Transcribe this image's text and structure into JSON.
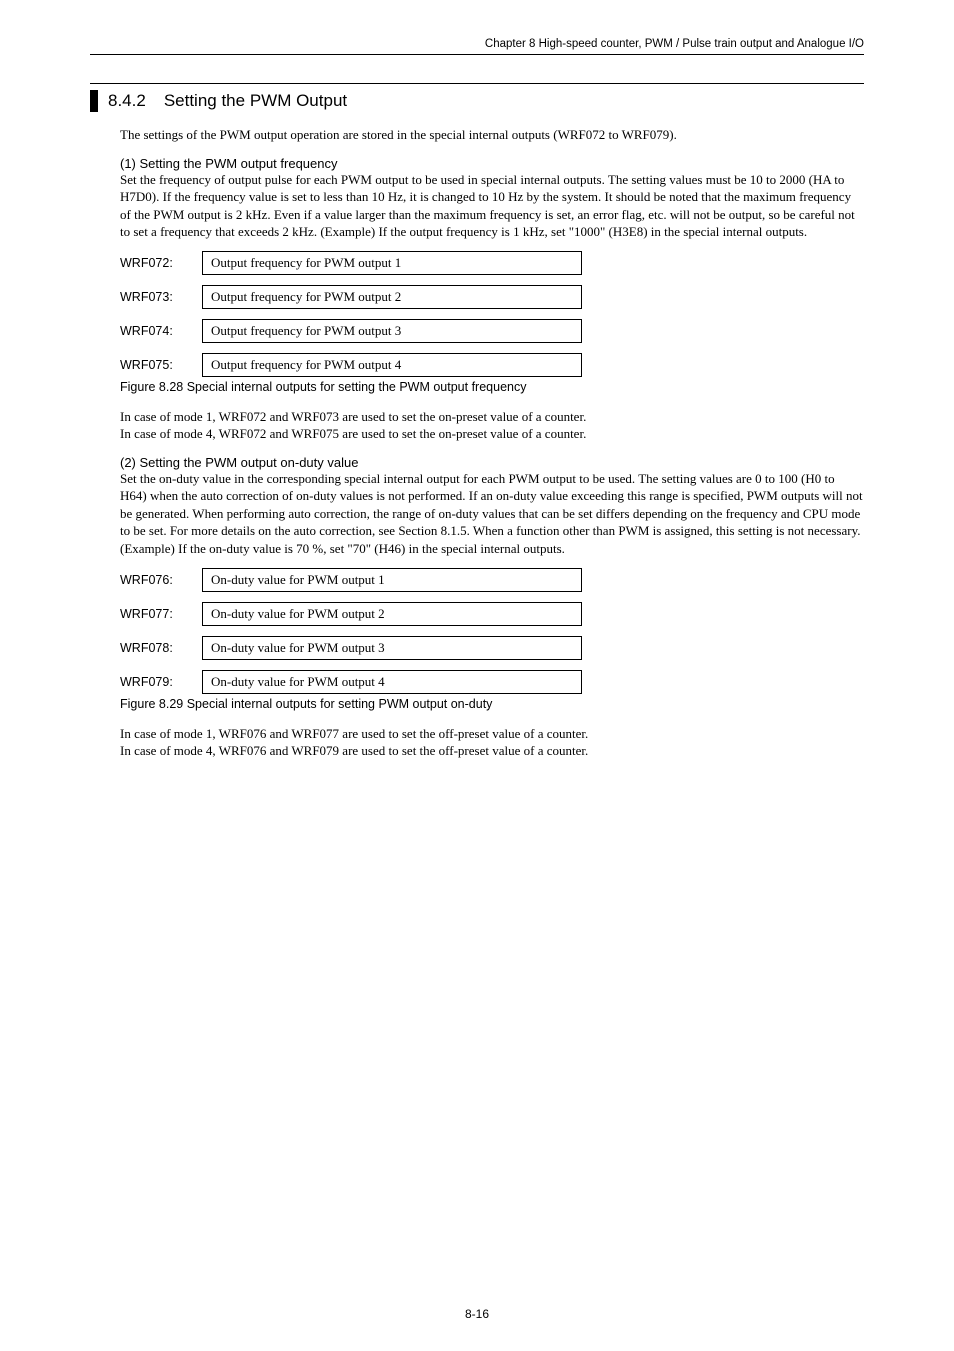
{
  "header": "Chapter 8  High-speed counter, PWM / Pulse train output and Analogue I/O",
  "section": {
    "number": "8.4.2",
    "title": "Setting the PWM Output"
  },
  "intro": "The settings of the PWM output operation are stored in the special internal outputs (WRF072 to WRF079).",
  "part1": {
    "heading": "(1)   Setting the PWM output frequency",
    "body": "Set the frequency of output pulse for each PWM output to be used in special internal outputs.  The setting values must be 10 to 2000 (HA to H7D0). If the frequency value is set to less than 10 Hz, it is changed to 10 Hz by the system. It should be noted that the maximum frequency of the PWM output is 2 kHz. Even if a value larger than the maximum frequency is set, an error flag, etc. will not be output, so be careful not to set a frequency that exceeds 2 kHz. (Example) If the output frequency is 1 kHz, set \"1000\" (H3E8) in the special internal outputs.",
    "regs": [
      {
        "label": "WRF072:",
        "desc": "Output frequency for PWM output 1"
      },
      {
        "label": "WRF073:",
        "desc": "Output frequency for PWM output 2"
      },
      {
        "label": "WRF074:",
        "desc": "Output frequency for PWM output 3"
      },
      {
        "label": "WRF075:",
        "desc": "Output frequency for PWM output 4"
      }
    ],
    "caption": "Figure 8.28 Special internal outputs for setting the PWM output frequency",
    "note1": "In case of mode 1, WRF072 and WRF073 are used to set the on-preset value of a counter.",
    "note2": "In case of mode 4, WRF072 and WRF075 are used to set the on-preset value of a counter."
  },
  "part2": {
    "heading": "(2)   Setting the PWM output on-duty value",
    "body": "Set the on-duty value in the corresponding special internal output for each PWM output to be used. The setting values are 0 to 100 (H0 to H64) when the auto correction of on-duty values is not performed. If an on-duty value exceeding this range is specified, PWM outputs will not be generated. When performing auto correction, the range of on-duty values that can be set differs depending on the frequency and CPU mode to be set. For more details on the auto correction, see Section 8.1.5. When a function other than PWM is assigned, this setting is not necessary.\n(Example) If the on-duty value is 70 %, set \"70\" (H46) in the special internal outputs.",
    "regs": [
      {
        "label": "WRF076:",
        "desc": "On-duty value for PWM output 1"
      },
      {
        "label": "WRF077:",
        "desc": "On-duty value for PWM output 2"
      },
      {
        "label": "WRF078:",
        "desc": "On-duty value for PWM output 3"
      },
      {
        "label": "WRF079:",
        "desc": "On-duty value for PWM output 4"
      }
    ],
    "caption": "Figure 8.29 Special internal outputs for setting PWM output on-duty",
    "note1": "In case of mode 1, WRF076 and WRF077 are used to set the off-preset value of a counter.",
    "note2": "In case of mode 4, WRF076 and WRF079 are used to set the off-preset value of a counter."
  },
  "pageNum": "8-16"
}
